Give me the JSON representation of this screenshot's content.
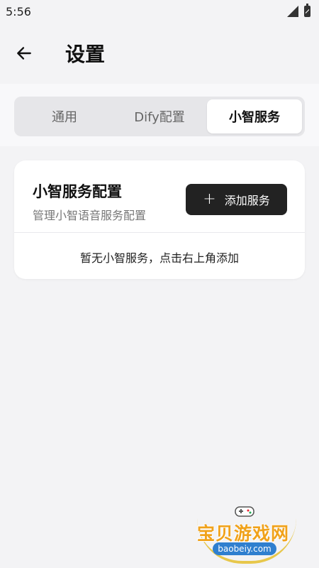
{
  "status_bar": {
    "time": "5:56"
  },
  "app_bar": {
    "title": "设置"
  },
  "tabs": [
    {
      "label": "通用",
      "active": false
    },
    {
      "label": "Dify配置",
      "active": false
    },
    {
      "label": "小智服务",
      "active": true
    }
  ],
  "card": {
    "title": "小智服务配置",
    "subtitle": "管理小智语音服务配置",
    "add_button_label": "添加服务",
    "empty_text": "暂无小智服务，点击右上角添加"
  },
  "watermark": {
    "name": "宝贝游戏网",
    "domain": "baobeiy.com"
  },
  "colors": {
    "background": "#f3f3f5",
    "primary_button": "#222222",
    "active_tab": "#ffffff"
  }
}
